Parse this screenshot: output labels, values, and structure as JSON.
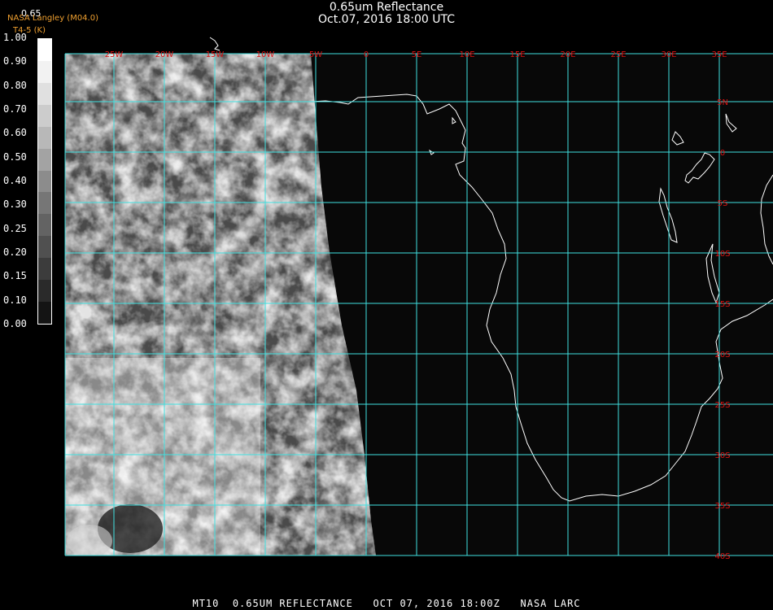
{
  "header": {
    "title": "0.65um Reflectance",
    "datetime": "Oct.07, 2016 18:00 UTC",
    "credit": "NASA Langley (M04.0)",
    "subtitle2": "T4-5 (K)",
    "product_code": "0.65"
  },
  "scale": {
    "labels": [
      "1.00",
      "0.90",
      "0.80",
      "0.70",
      "0.60",
      "0.50",
      "0.40",
      "0.30",
      "0.25",
      "0.20",
      "0.15",
      "0.10",
      "0.00"
    ],
    "colors": [
      "#ffffff",
      "#f2f2f2",
      "#e0e0e0",
      "#cccccc",
      "#b8b8b8",
      "#a3a3a3",
      "#8c8c8c",
      "#767676",
      "#636363",
      "#505050",
      "#3c3c3c",
      "#2a2a2a",
      "#141414"
    ]
  },
  "map": {
    "lon_labels": [
      "25W",
      "20W",
      "15W",
      "10W",
      "5W",
      "0",
      "5E",
      "10E",
      "15E",
      "20E",
      "25E",
      "30E",
      "35E"
    ],
    "lat_labels": [
      "5N",
      "0",
      "5S",
      "10S",
      "15S",
      "20S",
      "25S",
      "30S",
      "35S",
      "40S"
    ],
    "grid_color": "#40e0e0",
    "label_color": "#dd1111",
    "coast_color": "#ffffff"
  },
  "footer": {
    "text": "MT10  0.65UM REFLECTANCE   OCT 07, 2016 18:00Z   NASA LARC"
  }
}
